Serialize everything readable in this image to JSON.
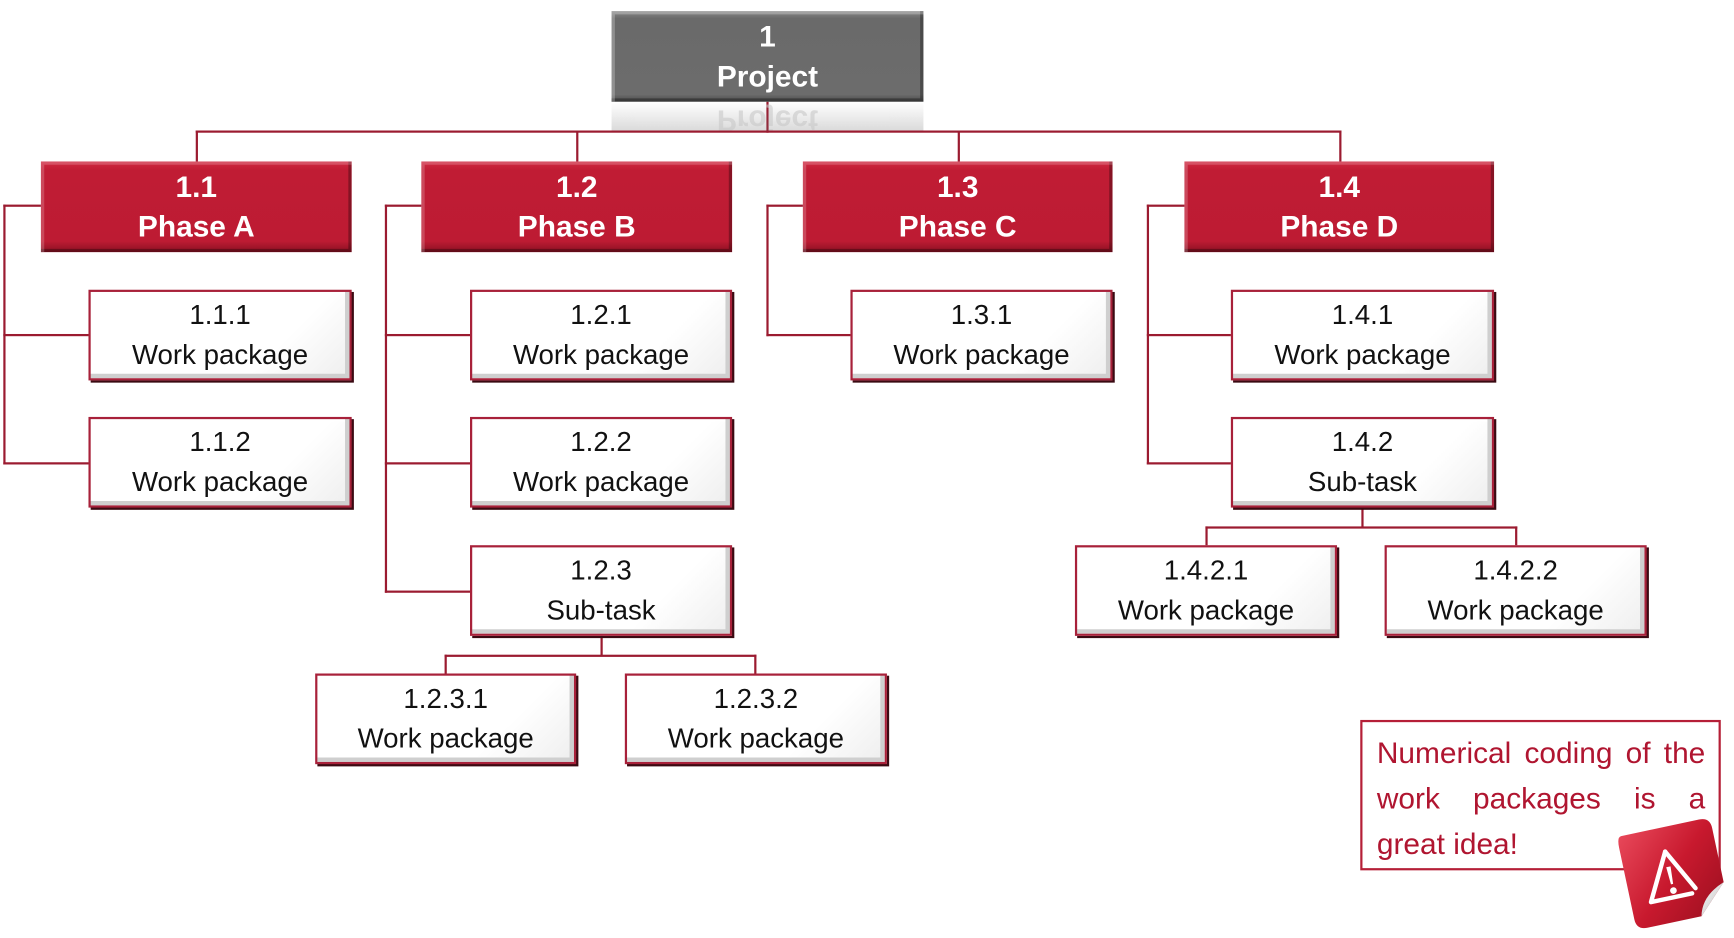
{
  "diagram": {
    "type": "work-breakdown-structure",
    "root": {
      "code": "1",
      "label": "Project"
    },
    "phases": [
      {
        "code": "1.1",
        "label": "Phase A",
        "children": [
          {
            "code": "1.1.1",
            "label": "Work package"
          },
          {
            "code": "1.1.2",
            "label": "Work package"
          }
        ]
      },
      {
        "code": "1.2",
        "label": "Phase B",
        "children": [
          {
            "code": "1.2.1",
            "label": "Work package"
          },
          {
            "code": "1.2.2",
            "label": "Work package"
          },
          {
            "code": "1.2.3",
            "label": "Sub-task",
            "children": [
              {
                "code": "1.2.3.1",
                "label": "Work package"
              },
              {
                "code": "1.2.3.2",
                "label": "Work package"
              }
            ]
          }
        ]
      },
      {
        "code": "1.3",
        "label": "Phase C",
        "children": [
          {
            "code": "1.3.1",
            "label": "Work package"
          }
        ]
      },
      {
        "code": "1.4",
        "label": "Phase D",
        "children": [
          {
            "code": "1.4.1",
            "label": "Work package"
          },
          {
            "code": "1.4.2",
            "label": "Sub-task",
            "children": [
              {
                "code": "1.4.2.1",
                "label": "Work package"
              },
              {
                "code": "1.4.2.2",
                "label": "Work package"
              }
            ]
          }
        ]
      }
    ]
  },
  "note": {
    "text": "Numerical coding of the work packages is a great idea!",
    "icon": "warning-sticker-icon"
  },
  "colors": {
    "phase": "#be1b34",
    "root": "#6e6e6e",
    "connector": "#9b1b30",
    "note_text": "#b01530"
  }
}
